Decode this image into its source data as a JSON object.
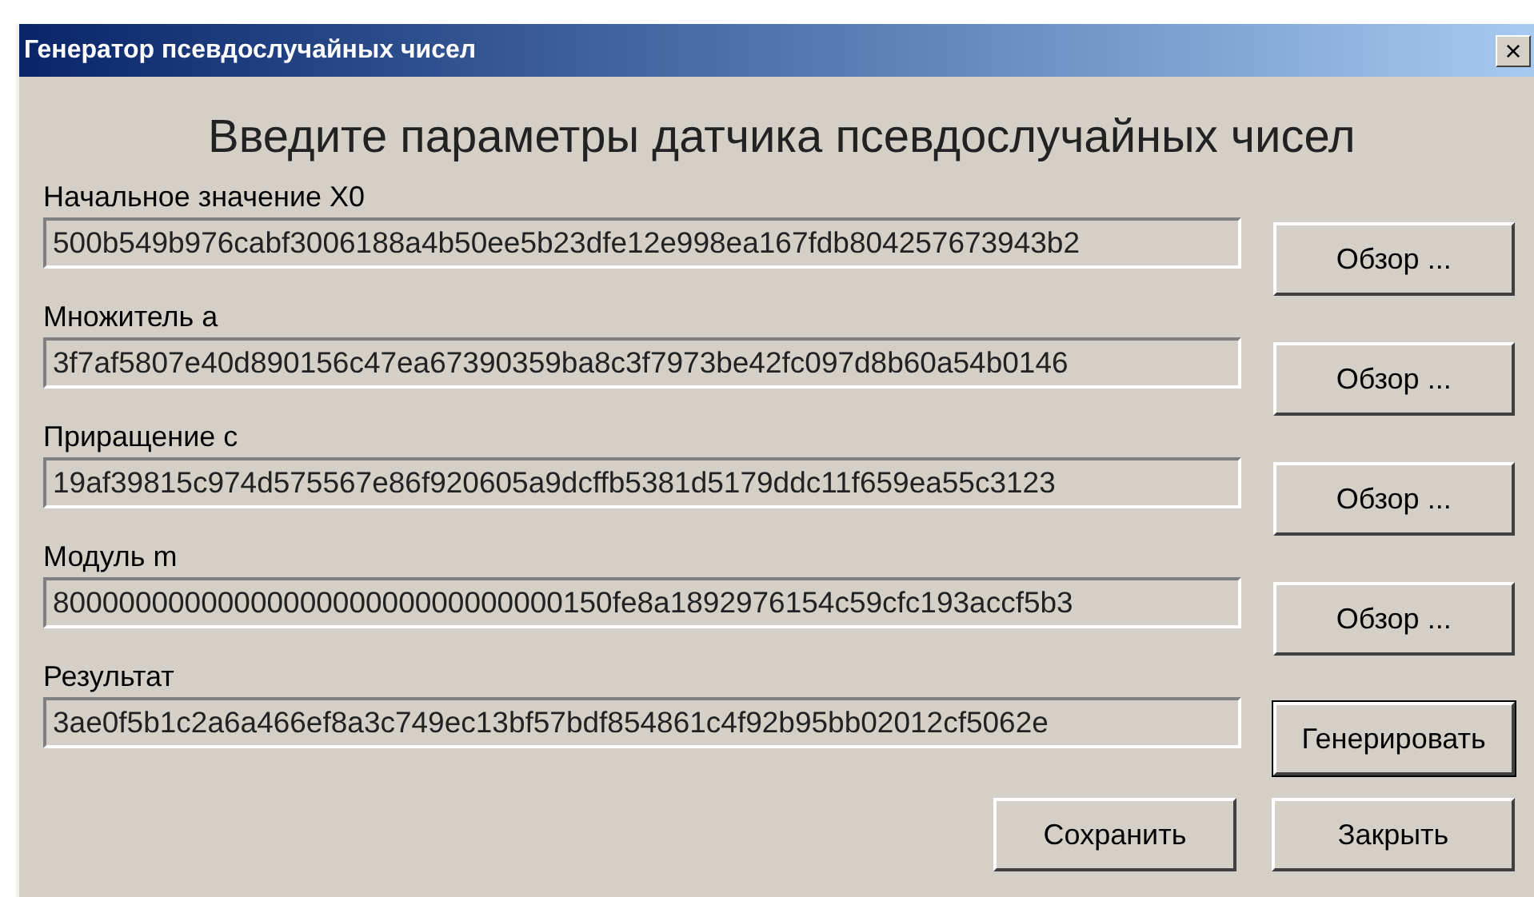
{
  "window": {
    "title": "Генератор псевдослучайных чисел",
    "close": "×"
  },
  "heading": "Введите параметры датчика псевдослучайных чисел",
  "fields": [
    {
      "label": "Начальное значение X0",
      "value": "500b549b976cabf3006188a4b50ee5b23dfe12e998ea167fdb804257673943b2",
      "button": {
        "label": "Обзор ...",
        "focused": false
      }
    },
    {
      "label": "Множитель a",
      "value": "3f7af5807e40d890156c47ea67390359ba8c3f7973be42fc097d8b60a54b0146",
      "button": {
        "label": "Обзор ...",
        "focused": false
      }
    },
    {
      "label": "Приращение c",
      "value": "19af39815c974d575567e86f920605a9dcffb5381d5179ddc11f659ea55c3123",
      "button": {
        "label": "Обзор ...",
        "focused": false
      }
    },
    {
      "label": "Модуль m",
      "value": "8000000000000000000000000000000150fe8a1892976154c59cfc193accf5b3",
      "button": {
        "label": "Обзор ...",
        "focused": false
      }
    },
    {
      "label": "Результат",
      "value": "3ae0f5b1c2a6a466ef8a3c749ec13bf57bdf854861c4f92b95bb02012cf5062e",
      "button": {
        "label": "Генерировать",
        "focused": true
      }
    }
  ],
  "buttons": [
    {
      "label": "Сохранить"
    },
    {
      "label": "Закрыть"
    }
  ]
}
